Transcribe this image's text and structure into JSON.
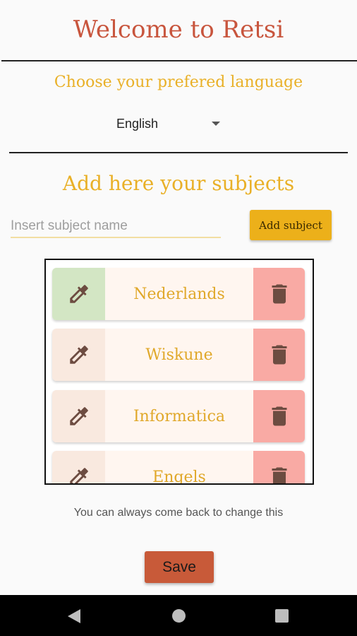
{
  "header": {
    "title": "Welcome to Retsi"
  },
  "language": {
    "heading": "Choose your prefered language",
    "selected": "English"
  },
  "subjects": {
    "heading": "Add here your subjects",
    "input_placeholder": "Insert subject name",
    "input_value": "",
    "add_button": "Add subject",
    "items": [
      {
        "name": "Nederlands",
        "active": true
      },
      {
        "name": "Wiskune",
        "active": false
      },
      {
        "name": "Informatica",
        "active": false
      },
      {
        "name": "Engels",
        "active": false
      }
    ]
  },
  "footer": {
    "hint": "You can always come back to change this",
    "save_button": "Save"
  },
  "colors": {
    "title": "#c8553d",
    "accent_yellow": "#e9b027",
    "add_button": "#ecb01a",
    "save_button": "#c85a39",
    "picker_active": "#d3e6c4",
    "picker_inactive": "#f9e9df",
    "delete_bg": "#f9aaa4",
    "icon": "#6d4c41"
  },
  "icons": {
    "picker": "eyedropper-icon",
    "delete": "trash-icon",
    "nav_back": "back-triangle-icon",
    "nav_home": "home-circle-icon",
    "nav_recent": "recents-square-icon"
  }
}
